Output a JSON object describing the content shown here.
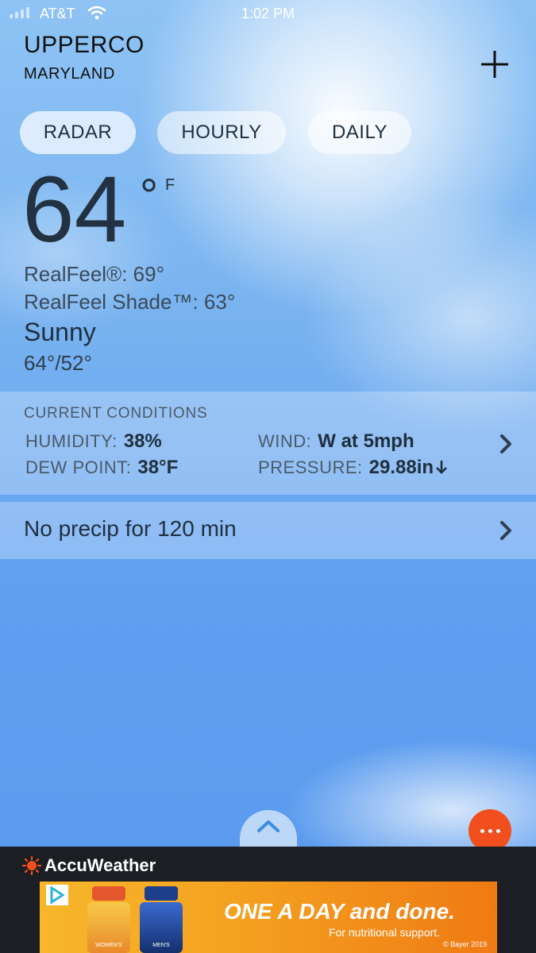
{
  "status_bar": {
    "carrier": "AT&T",
    "time": "1:02 PM",
    "icons": [
      "signal-icon",
      "wifi-icon"
    ]
  },
  "location": {
    "city": "UPPERCO",
    "state": "MARYLAND",
    "add_icon": "plus-icon"
  },
  "tabs": [
    {
      "label": "RADAR",
      "active": true
    },
    {
      "label": "HOURLY",
      "active": false
    },
    {
      "label": "DAILY",
      "active": false
    }
  ],
  "current": {
    "temperature": "64",
    "degree_symbol": "°",
    "unit": "F",
    "realfeel": "RealFeel®: 69°",
    "realfeel_shade": "RealFeel Shade™: 63°",
    "condition": "Sunny",
    "hi_lo": "64°/52°"
  },
  "conditions": {
    "title": "CURRENT CONDITIONS",
    "humidity_label": "HUMIDITY:",
    "humidity_value": "38%",
    "wind_label": "WIND:",
    "wind_value": "W at 5mph",
    "dew_point_label": "DEW POINT:",
    "dew_point_value": "38°F",
    "pressure_label": "PRESSURE:",
    "pressure_value": "29.88in",
    "pressure_trend_icon": "arrow-down-icon",
    "chevron_icon": "chevron-right-icon"
  },
  "precip": {
    "text": "No precip for 120 min",
    "chevron_icon": "chevron-right-icon"
  },
  "controls": {
    "expand_icon": "chevron-up-icon",
    "more_icon": "ellipsis-icon"
  },
  "brand": {
    "name": "AccuWeather",
    "logo_icon": "sun-icon",
    "accent": "#f1501e"
  },
  "ad": {
    "headline": "ONE A DAY and done.",
    "subline": "For nutritional support.",
    "copyright": "© Bayer 2019",
    "choices_icon": "adchoices-icon",
    "bottle_women": "WOMEN'S",
    "bottle_men": "MEN'S"
  },
  "colors": {
    "sky_top": "#8fc3f5",
    "sky_bottom": "#5c9cee",
    "footer": "#1b1e22",
    "ad_orange": "#f4a020"
  }
}
